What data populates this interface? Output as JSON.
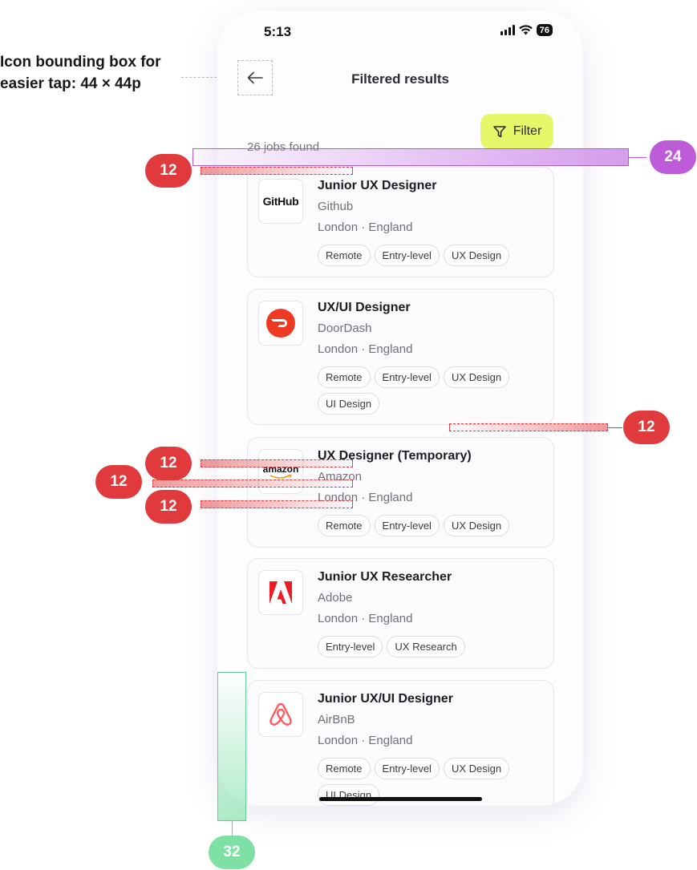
{
  "annotation": {
    "bounding_box_note_line1": "Icon bounding box for",
    "bounding_box_note_line2": "easier tap: 44 × 44p",
    "spacing_labels": [
      "12",
      "24",
      "12",
      "12",
      "12",
      "12",
      "32"
    ]
  },
  "status_bar": {
    "time": "5:13",
    "battery": "76"
  },
  "header": {
    "back_icon": "arrow-left-icon",
    "title": "Filtered results"
  },
  "filter_button": {
    "label": "Filter",
    "icon": "filter-icon",
    "color": "#e6f86a"
  },
  "results": {
    "count_text": "26 jobs found"
  },
  "jobs": [
    {
      "title": "Junior UX Designer",
      "company": "Github",
      "location": "London · England",
      "logo": "GitHub",
      "tags": [
        "Remote",
        "Entry-level",
        "UX Design"
      ]
    },
    {
      "title": "UX/UI Designer",
      "company": "DoorDash",
      "location": "London · England",
      "logo": "doordash-logo-icon",
      "tags": [
        "Remote",
        "Entry-level",
        "UX Design",
        "UI Design"
      ]
    },
    {
      "title": "UX Designer (Temporary)",
      "company": "Amazon",
      "location": "London · England",
      "logo": "amazon",
      "tags": [
        "Remote",
        "Entry-level",
        "UX Design"
      ]
    },
    {
      "title": "Junior UX Researcher",
      "company": "Adobe",
      "location": "London · England",
      "logo": "adobe-logo-icon",
      "tags": [
        "Entry-level",
        "UX Research"
      ]
    },
    {
      "title": "Junior UX/UI Designer",
      "company": "AirBnB",
      "location": "London · England",
      "logo": "airbnb-logo-icon",
      "tags": [
        "Remote",
        "Entry-level",
        "UX Design",
        "UI Design"
      ]
    }
  ],
  "colors": {
    "spacing_red": "#e03a3c",
    "spacing_purple": "#bd5bd9",
    "spacing_green": "#7fe0a6"
  }
}
